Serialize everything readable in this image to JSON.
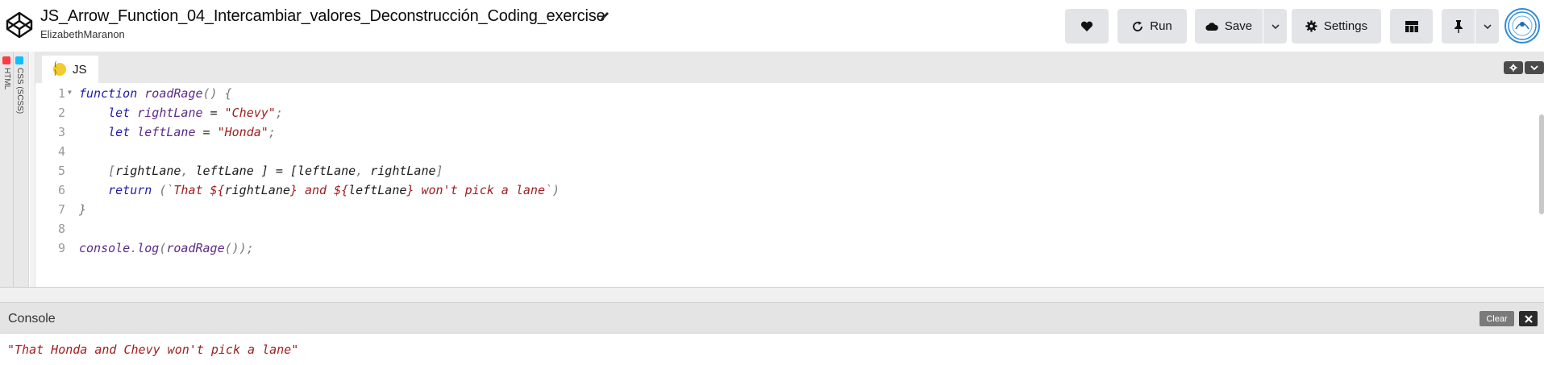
{
  "header": {
    "title": "JS_Arrow_Function_04_Intercambiar_valores_Deconstrucción_Coding_exercise",
    "author": "ElizabethMaranon",
    "buttons": {
      "run": "Run",
      "save": "Save",
      "settings": "Settings"
    },
    "icons": {
      "logo": "codepen-logo-icon",
      "edit": "pencil-icon",
      "heart": "heart-icon",
      "run": "refresh-icon",
      "save": "cloud-icon",
      "settings": "gear-icon",
      "layout": "layout-grid-icon",
      "pin": "pin-icon",
      "dropdown": "chevron-down-icon"
    }
  },
  "side_tabs": [
    {
      "label": "HTML",
      "color": "#ff3c41"
    },
    {
      "label": "CSS (SCSS)",
      "color": "#0ebeff"
    }
  ],
  "editor": {
    "tab_label": "JS",
    "tab_icon": "js-icon",
    "tab_icon_glyph": "( )",
    "lines": [
      {
        "num": "1"
      },
      {
        "num": "2"
      },
      {
        "num": "3"
      },
      {
        "num": "4"
      },
      {
        "num": "5"
      },
      {
        "num": "6"
      },
      {
        "num": "7"
      },
      {
        "num": "8"
      },
      {
        "num": "9"
      }
    ],
    "tokens": {
      "function_kw": "function",
      "fn_name": "roadRage",
      "paren_open_brace": "() {",
      "let_kw": "let",
      "right_lane": "rightLane",
      "left_lane": "leftLane",
      "assign": " = ",
      "chevy_str": "\"Chevy\"",
      "honda_str": "\"Honda\"",
      "semicolon": ";",
      "bracket_open": "[",
      "comma": ", ",
      "bracket_close_assign": " ] = [",
      "bracket_close": "]",
      "return_kw": "return",
      "paren_open_tpl": " (`",
      "tpl_1": "That ${",
      "tpl_2": "} and ${",
      "tpl_3": "} won't pick a lane",
      "tpl_close": "`)",
      "close_brace": "}",
      "console": "console",
      "dot": ".",
      "log": "log",
      "call_open": "(",
      "call_close": "());"
    }
  },
  "console": {
    "title": "Console",
    "clear_label": "Clear",
    "output": "\"That Honda and Chevy won't pick a lane\""
  }
}
